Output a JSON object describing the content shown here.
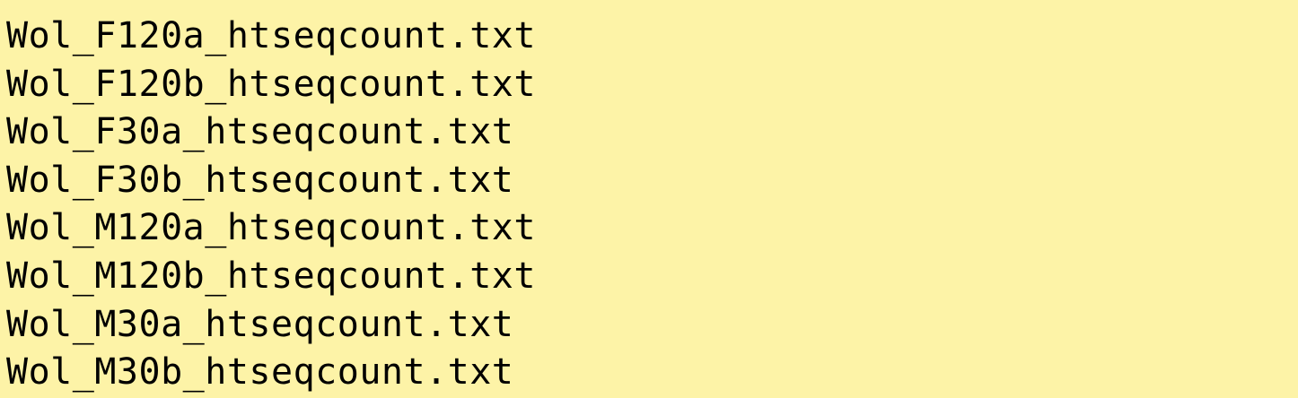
{
  "output": {
    "lines": [
      "Wol_F120a_htseqcount.txt",
      "Wol_F120b_htseqcount.txt",
      "Wol_F30a_htseqcount.txt",
      "Wol_F30b_htseqcount.txt",
      "Wol_M120a_htseqcount.txt",
      "Wol_M120b_htseqcount.txt",
      "Wol_M30a_htseqcount.txt",
      "Wol_M30b_htseqcount.txt"
    ]
  },
  "colors": {
    "background": "#fdf3a7",
    "text": "#000000"
  }
}
